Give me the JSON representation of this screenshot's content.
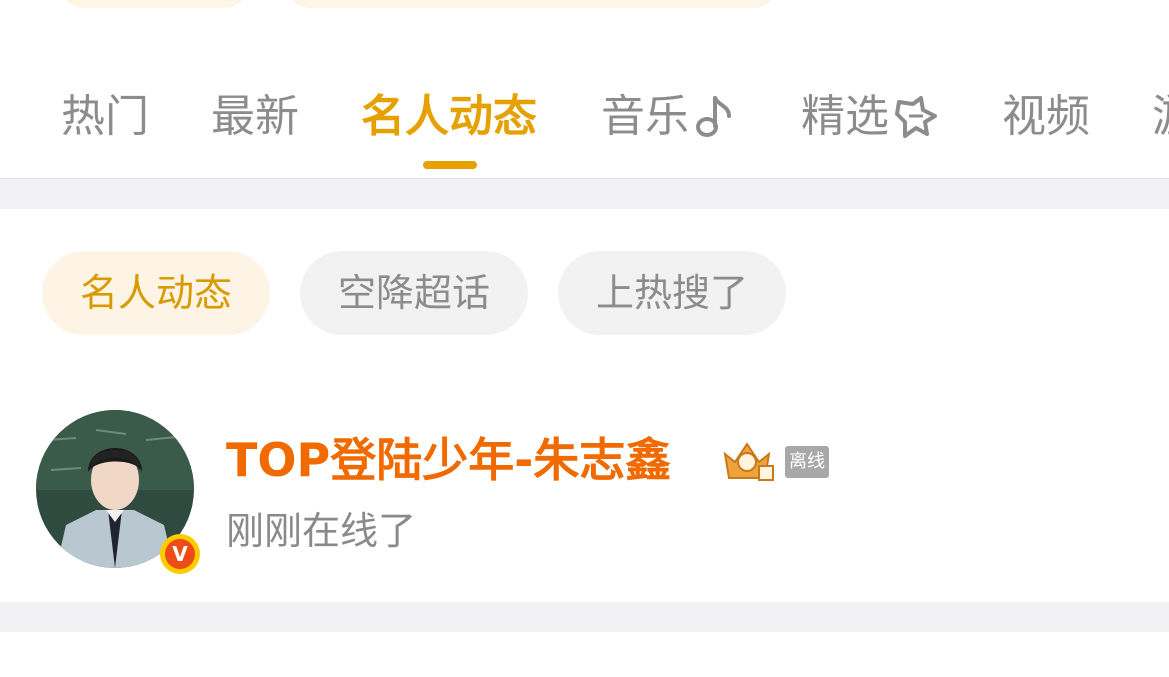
{
  "tabs": [
    {
      "label": "热门",
      "active": false
    },
    {
      "label": "最新",
      "active": false
    },
    {
      "label": "名人动态",
      "active": true
    },
    {
      "label": "音乐",
      "icon": "music-note-icon",
      "active": false
    },
    {
      "label": "精选",
      "icon": "star-badge-icon",
      "active": false
    },
    {
      "label": "视频",
      "active": false
    },
    {
      "label": "游",
      "active": false
    }
  ],
  "sub_tabs": [
    {
      "label": "名人动态",
      "active": true
    },
    {
      "label": "空降超话",
      "active": false
    },
    {
      "label": "上热搜了",
      "active": false
    }
  ],
  "user": {
    "name": "TOP登陆少年-朱志鑫",
    "verified_badge": "V",
    "crown_icon": "crown-badge-icon",
    "status_badge": "离线",
    "activity": "刚刚在线了"
  },
  "colors": {
    "accent": "#e6a100",
    "username": "#f06a00",
    "inactive_text": "#8c8c8c"
  }
}
